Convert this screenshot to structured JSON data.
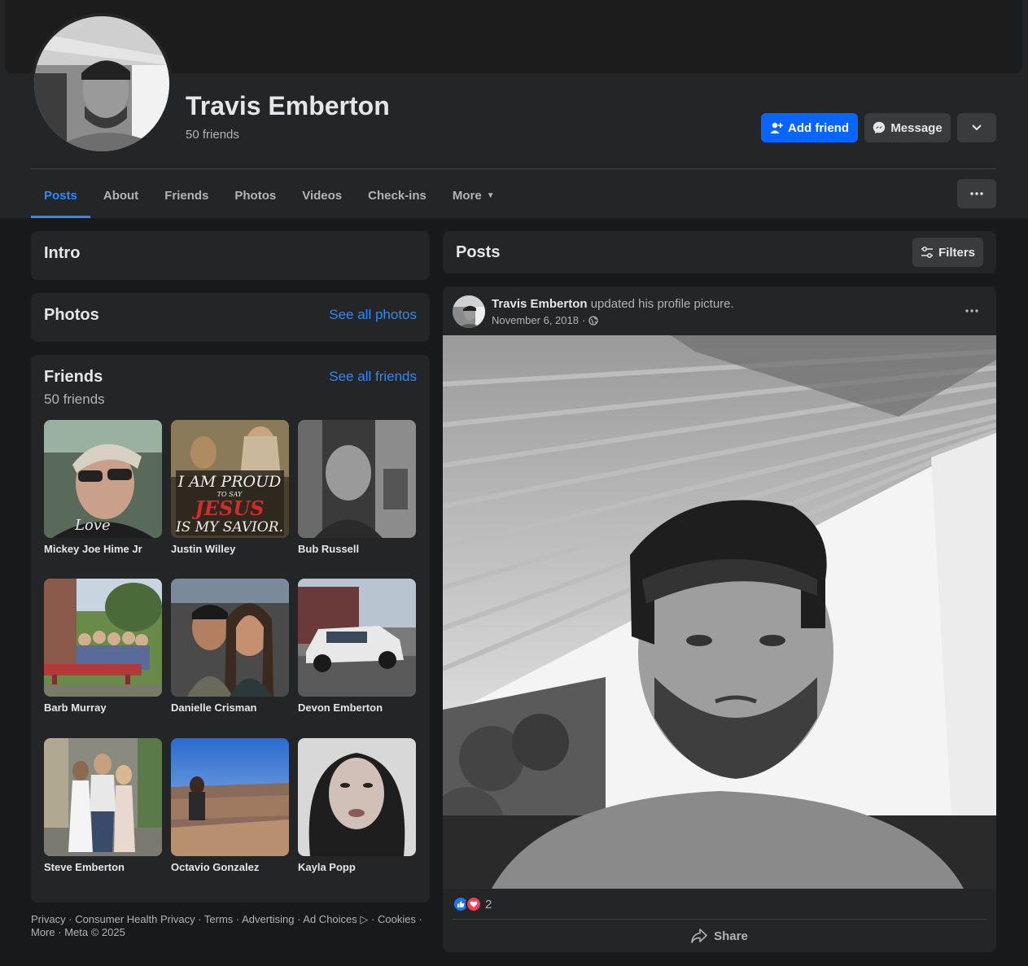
{
  "profile": {
    "name": "Travis Emberton",
    "friends_count": "50 friends"
  },
  "actions": {
    "add_friend": "Add friend",
    "message": "Message"
  },
  "nav": {
    "tabs": [
      "Posts",
      "About",
      "Friends",
      "Photos",
      "Videos",
      "Check-ins"
    ],
    "more": "More",
    "active": "Posts"
  },
  "intro": {
    "title": "Intro"
  },
  "photos": {
    "title": "Photos",
    "see_all": "See all photos"
  },
  "friends": {
    "title": "Friends",
    "count": "50 friends",
    "see_all": "See all friends",
    "list": [
      "Mickey Joe Hime Jr",
      "Justin Willey",
      "Bub Russell",
      "Barb Murray",
      "Danielle Crisman",
      "Devon Emberton",
      "Steve Emberton",
      "Octavio Gonzalez",
      "Kayla Popp"
    ],
    "justin_image_text": {
      "line1": "I AM PROUD",
      "line2": "TO SAY",
      "line3": "JESUS",
      "line4": "IS MY SAVIOR."
    },
    "mickey_image_text": "Love"
  },
  "footer": {
    "links": [
      "Privacy",
      "Consumer Health Privacy",
      "Terms",
      "Advertising",
      "Ad Choices",
      "Cookies",
      "More"
    ],
    "copyright": "Meta © 2025"
  },
  "posts": {
    "title": "Posts",
    "filters": "Filters",
    "post": {
      "author": "Travis Emberton",
      "action": "updated his profile picture.",
      "date": "November 6, 2018",
      "reaction_count": "2",
      "share": "Share"
    }
  },
  "colors": {
    "accent": "#0866ff",
    "link": "#2d88ff",
    "card": "#242526",
    "page": "#18191a"
  }
}
